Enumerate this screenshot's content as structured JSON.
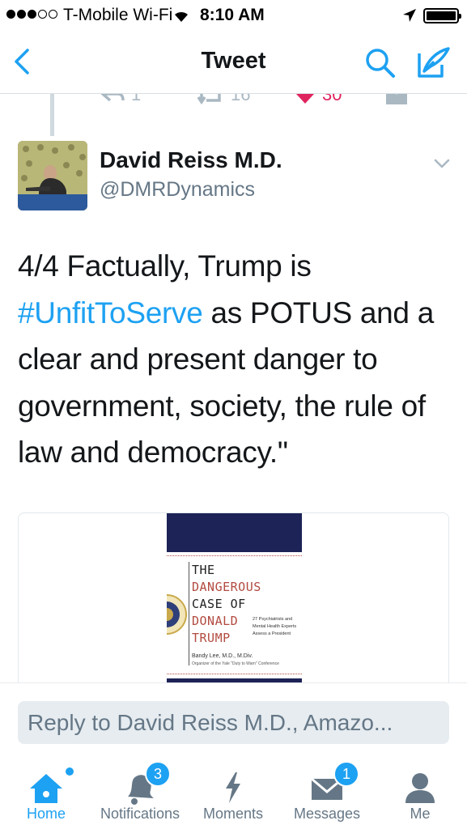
{
  "status_bar": {
    "carrier": "T-Mobile Wi-Fi",
    "time": "8:10 AM",
    "signal_bars_filled": 3,
    "signal_bars_total": 5
  },
  "nav": {
    "title": "Tweet",
    "icons": {
      "back": "chevron-left-icon",
      "search": "search-icon",
      "compose": "compose-icon"
    }
  },
  "previous_tweet_actions": {
    "reply_count": "1",
    "retweet_count": "16",
    "like_count": "30"
  },
  "tweet": {
    "author_name": "David Reiss M.D.",
    "author_handle": "@DMRDynamics",
    "text_before": "4/4 Factually, Trump is ",
    "hashtag": "#UnfitToServe",
    "text_after": " as POTUS and a clear and present danger to government, society, the rule of law and democracy.\""
  },
  "card": {
    "book_title_lines": [
      "THE",
      "DANGEROUS",
      "CASE OF",
      "DONALD",
      "TRUMP"
    ],
    "book_subtitle": "27 Psychiatrists and Mental Health Experts Assess a President",
    "book_author": "Bandy Lee, M.D., M.Div.",
    "book_org": "Organizer of the Yale \"Duty to Warn\" Conference"
  },
  "reply": {
    "placeholder": "Reply to David Reiss M.D., Amazo..."
  },
  "tabs": [
    {
      "label": "Home",
      "icon": "home-icon",
      "active": true,
      "badge": ""
    },
    {
      "label": "Notifications",
      "icon": "bell-icon",
      "active": false,
      "badge": "3"
    },
    {
      "label": "Moments",
      "icon": "lightning-icon",
      "active": false,
      "badge": ""
    },
    {
      "label": "Messages",
      "icon": "envelope-icon",
      "active": false,
      "badge": "1"
    },
    {
      "label": "Me",
      "icon": "person-icon",
      "active": false,
      "badge": ""
    }
  ],
  "colors": {
    "accent": "#1da1f2",
    "like": "#e0245e",
    "text": "#14171a",
    "secondary_text": "#657786"
  }
}
